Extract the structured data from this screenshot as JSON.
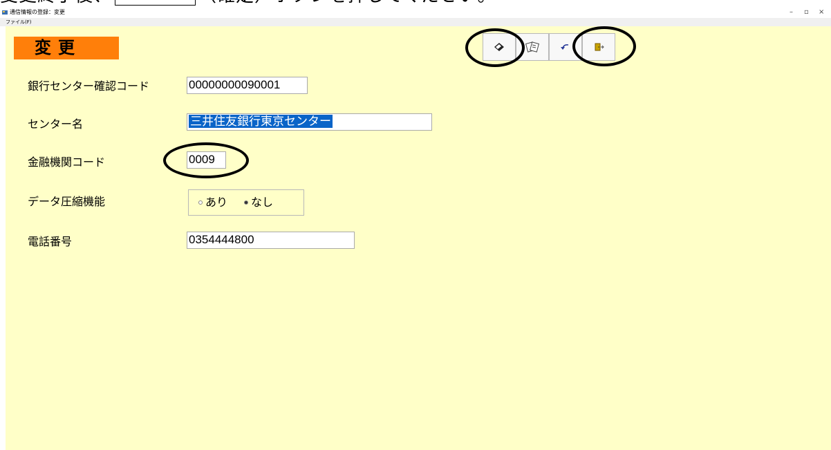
{
  "instruction": {
    "before": "変更終了後、",
    "after": "（確定）ボタンを押してください。"
  },
  "window": {
    "title": "通信情報の登録：変更",
    "minimize": "–",
    "maximize": "▫",
    "close": "×"
  },
  "menu": {
    "file": "ファイル(F)"
  },
  "mode_badge": "変更",
  "toolbar": {
    "buttons": [
      {
        "icon": "confirm-icon"
      },
      {
        "icon": "print-icon"
      },
      {
        "icon": "undo-icon"
      },
      {
        "icon": "exit-icon"
      }
    ]
  },
  "fields": {
    "bank_center_code": {
      "label": "銀行センター確認コード",
      "value": "00000000090001"
    },
    "center_name": {
      "label": "センター名",
      "value": "三井住友銀行東京センター"
    },
    "institution_code": {
      "label": "金融機関コード",
      "value": "0009"
    },
    "compression": {
      "label": "データ圧縮機能",
      "options": [
        "あり",
        "なし"
      ],
      "selected": "なし"
    },
    "phone": {
      "label": "電話番号",
      "value": "0354444800"
    }
  },
  "colors": {
    "form_bg": "#ffffc8",
    "badge_bg": "#ff7f0a",
    "selection": "#0a64c8"
  }
}
